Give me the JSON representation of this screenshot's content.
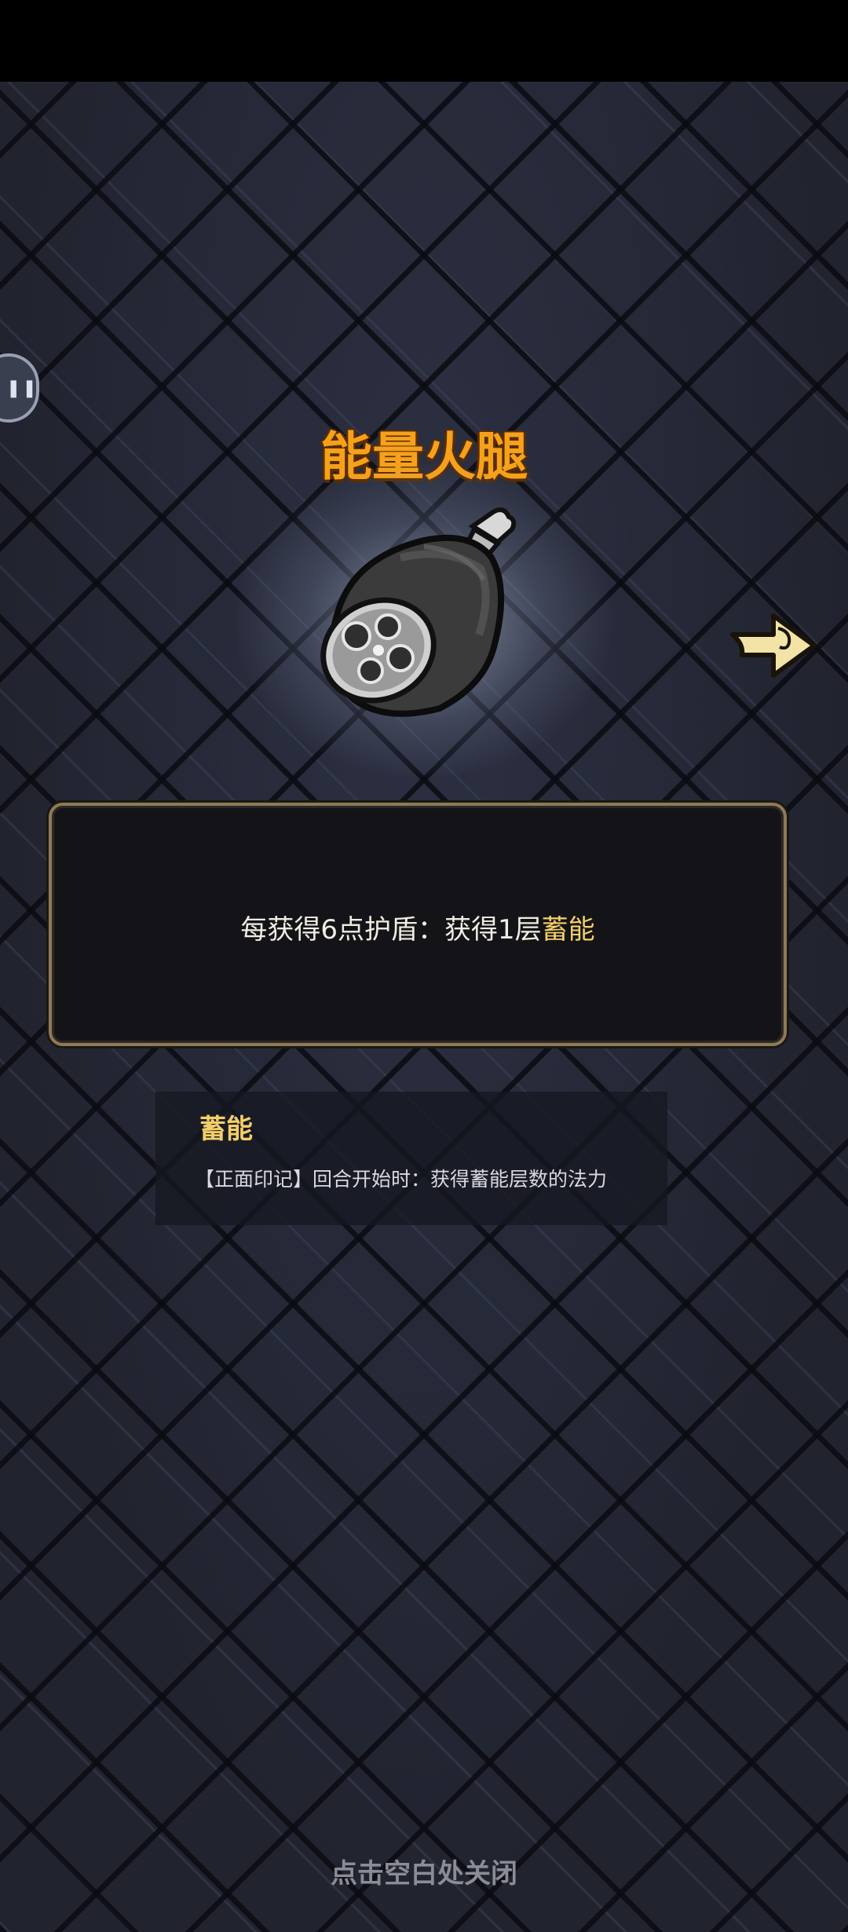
{
  "item": {
    "name": "能量火腿",
    "icon": "meat-ham-icon",
    "description_prefix": "每获得6点护盾：获得1层",
    "description_keyword": "蓄能"
  },
  "keyword_tip": {
    "title": "蓄能",
    "body": "【正面印记】回合开始时：获得蓄能层数的法力"
  },
  "close_hint": "点击空白处关闭",
  "colors": {
    "title": "#f6a11c",
    "keyword": "#f5cf66",
    "box_border": "#8e7a58",
    "background": "#262939"
  }
}
